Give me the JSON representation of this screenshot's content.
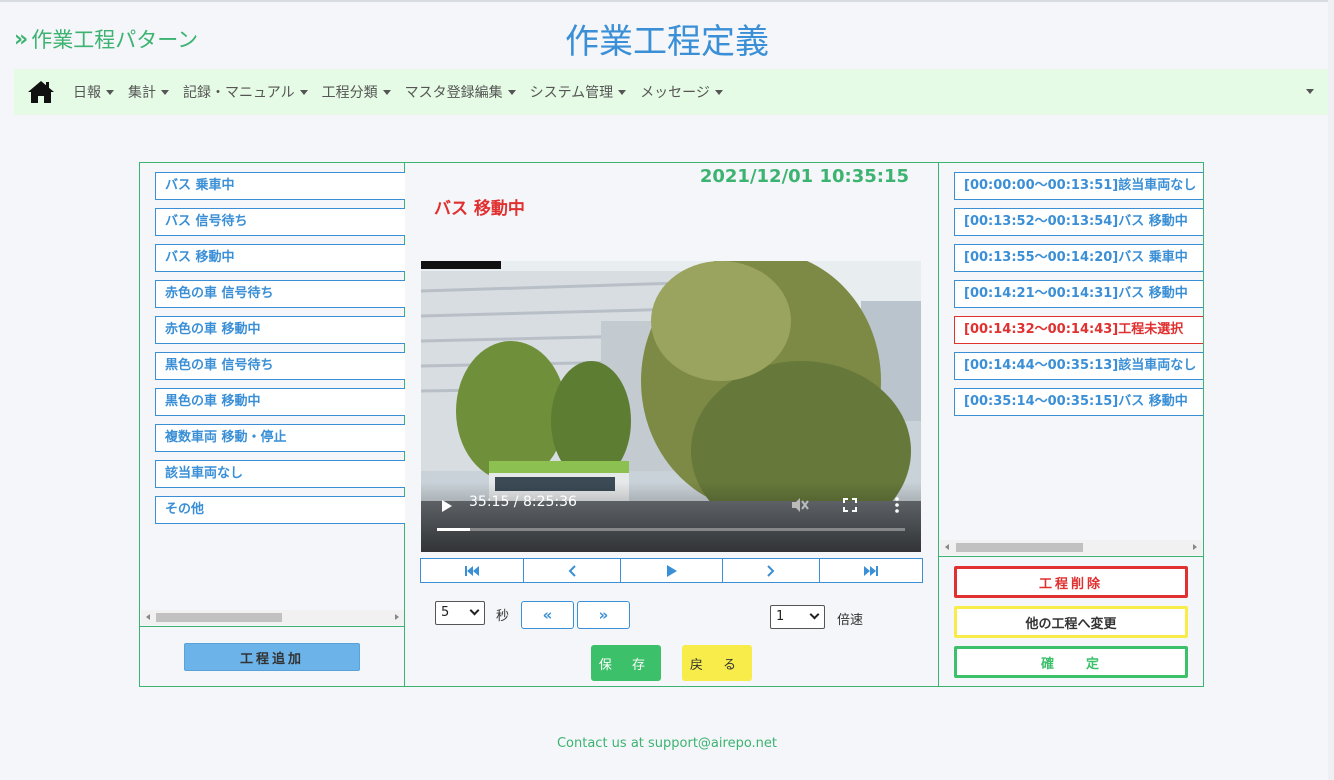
{
  "header": {
    "brand": "作業工程パターン",
    "title": "作業工程定義"
  },
  "nav": {
    "items": [
      "日報",
      "集計",
      "記録・マニュアル",
      "工程分類",
      "マスタ登録編集",
      "システム管理",
      "メッセージ"
    ]
  },
  "process_list": {
    "items": [
      "バス 乗車中",
      "バス 信号待ち",
      "バス 移動中",
      "赤色の車 信号待ち",
      "赤色の車 移動中",
      "黒色の車 信号待ち",
      "黒色の車 移動中",
      "複数車両 移動・停止",
      "該当車両なし",
      "その他"
    ],
    "add_label": "工程追加"
  },
  "player": {
    "timestamp": "2021/12/01 10:35:15",
    "current_process": "バス 移動中",
    "time_display": "35:15 / 8:25:36",
    "progress": 0.07,
    "skip_seconds": "5",
    "skip_unit": "秒",
    "speed": "1",
    "speed_unit": "倍速",
    "save_label": "保 存",
    "back_label": "戻 る"
  },
  "segments": {
    "items": [
      {
        "label": "[00:00:00～00:13:51]該当車両なし",
        "unselected": false
      },
      {
        "label": "[00:13:52～00:13:54]バス 移動中",
        "unselected": false
      },
      {
        "label": "[00:13:55～00:14:20]バス 乗車中",
        "unselected": false
      },
      {
        "label": "[00:14:21～00:14:31]バス 移動中",
        "unselected": false
      },
      {
        "label": "[00:14:32～00:14:43]工程未選択",
        "unselected": true
      },
      {
        "label": "[00:14:44～00:35:13]該当車両なし",
        "unselected": false
      },
      {
        "label": "[00:35:14～00:35:15]バス 移動中",
        "unselected": false
      }
    ],
    "delete_label": "工程削除",
    "change_label": "他の工程へ変更",
    "confirm_label": "確　　定"
  },
  "footer": {
    "contact": "Contact us at support@airepo.net"
  },
  "colors": {
    "accent_green": "#3cb371",
    "accent_blue": "#3a8fd6",
    "alert_red": "#e03030",
    "nav_bg": "#e5fbe5"
  }
}
